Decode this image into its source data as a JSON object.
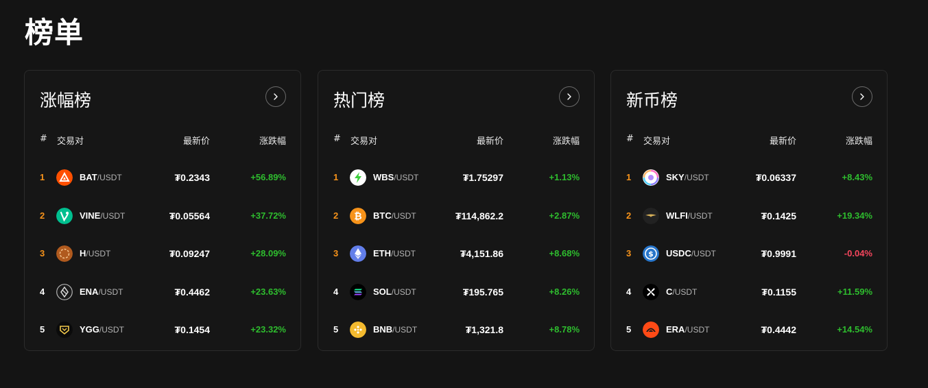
{
  "page": {
    "title": "榜单"
  },
  "colors": {
    "up": "#2ebd2e",
    "down": "#f6465d",
    "rank_top": "#f7931a"
  },
  "boards": [
    {
      "title": "涨幅榜",
      "headers": {
        "rank": "#",
        "pair": "交易对",
        "price": "最新价",
        "change": "涨跌幅"
      },
      "rows": [
        {
          "rank": "1",
          "base": "BAT",
          "quote": "/USDT",
          "price": "₮0.2343",
          "change": "+56.89%",
          "dir": "up",
          "icon": "bat-icon"
        },
        {
          "rank": "2",
          "base": "VINE",
          "quote": "/USDT",
          "price": "₮0.05564",
          "change": "+37.72%",
          "dir": "up",
          "icon": "vine-icon"
        },
        {
          "rank": "3",
          "base": "H",
          "quote": "/USDT",
          "price": "₮0.09247",
          "change": "+28.09%",
          "dir": "up",
          "icon": "h-icon"
        },
        {
          "rank": "4",
          "base": "ENA",
          "quote": "/USDT",
          "price": "₮0.4462",
          "change": "+23.63%",
          "dir": "up",
          "icon": "ena-icon"
        },
        {
          "rank": "5",
          "base": "YGG",
          "quote": "/USDT",
          "price": "₮0.1454",
          "change": "+23.32%",
          "dir": "up",
          "icon": "ygg-icon"
        }
      ]
    },
    {
      "title": "热门榜",
      "headers": {
        "rank": "#",
        "pair": "交易对",
        "price": "最新价",
        "change": "涨跌幅"
      },
      "rows": [
        {
          "rank": "1",
          "base": "WBS",
          "quote": "/USDT",
          "price": "₮1.75297",
          "change": "+1.13%",
          "dir": "up",
          "icon": "wbs-icon"
        },
        {
          "rank": "2",
          "base": "BTC",
          "quote": "/USDT",
          "price": "₮114,862.2",
          "change": "+2.87%",
          "dir": "up",
          "icon": "btc-icon"
        },
        {
          "rank": "3",
          "base": "ETH",
          "quote": "/USDT",
          "price": "₮4,151.86",
          "change": "+8.68%",
          "dir": "up",
          "icon": "eth-icon"
        },
        {
          "rank": "4",
          "base": "SOL",
          "quote": "/USDT",
          "price": "₮195.765",
          "change": "+8.26%",
          "dir": "up",
          "icon": "sol-icon"
        },
        {
          "rank": "5",
          "base": "BNB",
          "quote": "/USDT",
          "price": "₮1,321.8",
          "change": "+8.78%",
          "dir": "up",
          "icon": "bnb-icon"
        }
      ]
    },
    {
      "title": "新币榜",
      "headers": {
        "rank": "#",
        "pair": "交易对",
        "price": "最新价",
        "change": "涨跌幅"
      },
      "rows": [
        {
          "rank": "1",
          "base": "SKY",
          "quote": "/USDT",
          "price": "₮0.06337",
          "change": "+8.43%",
          "dir": "up",
          "icon": "sky-icon"
        },
        {
          "rank": "2",
          "base": "WLFI",
          "quote": "/USDT",
          "price": "₮0.1425",
          "change": "+19.34%",
          "dir": "up",
          "icon": "wlfi-icon"
        },
        {
          "rank": "3",
          "base": "USDC",
          "quote": "/USDT",
          "price": "₮0.9991",
          "change": "-0.04%",
          "dir": "down",
          "icon": "usdc-icon"
        },
        {
          "rank": "4",
          "base": "C",
          "quote": "/USDT",
          "price": "₮0.1155",
          "change": "+11.59%",
          "dir": "up",
          "icon": "c-icon"
        },
        {
          "rank": "5",
          "base": "ERA",
          "quote": "/USDT",
          "price": "₮0.4442",
          "change": "+14.54%",
          "dir": "up",
          "icon": "era-icon"
        }
      ]
    }
  ]
}
